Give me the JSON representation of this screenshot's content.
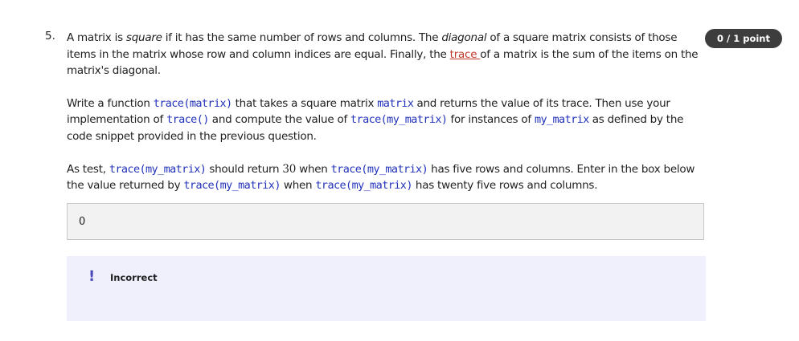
{
  "question": {
    "number": "5.",
    "score": "0 / 1 point",
    "p1": {
      "a": "A matrix is ",
      "square": "square",
      "b": " if it has the same number of rows and columns. The ",
      "diagonal": "diagonal",
      "c": " of a square matrix consists of those items in the matrix whose row and column indices are equal. Finally, the ",
      "trace_link": "trace ",
      "d": "of a matrix is the sum of the items on the matrix's diagonal."
    },
    "p2": {
      "a": "Write a function ",
      "c1": "trace(matrix)",
      "b": " that takes a square matrix ",
      "c2": "matrix",
      "c": " and returns the value of its trace.  Then use your implementation of ",
      "c3": "trace()",
      "d": " and compute the value of ",
      "c4": "trace(my_matrix)",
      "e": " for instances of ",
      "c5": "my_matrix",
      "f": " as defined by the code snippet provided in the previous question."
    },
    "p3": {
      "a": "As test, ",
      "c1": "trace(my_matrix)",
      "b": " should return ",
      "n": "30",
      "c": " when ",
      "c2": "trace(my_matrix)",
      "d": " has five rows and columns.  Enter in the box below the value returned by ",
      "c3": "trace(my_matrix)",
      "e": " when ",
      "c4": "trace(my_matrix)",
      "f": " has twenty five rows and columns."
    },
    "answer_value": "0",
    "feedback": {
      "icon": "exclamation-icon",
      "label": "Incorrect"
    }
  }
}
